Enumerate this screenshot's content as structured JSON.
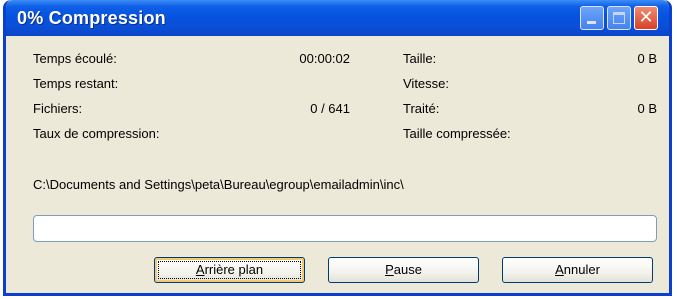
{
  "window": {
    "title": "0% Compression",
    "controls": {
      "minimize": "minimize-icon",
      "maximize": "maximize-icon",
      "close": "close-icon"
    }
  },
  "stats": {
    "elapsed_label": "Temps écoulé:",
    "elapsed_value": "00:00:02",
    "remaining_label": "Temps restant:",
    "files_label": "Fichiers:",
    "files_value": "0 / 641",
    "ratio_label": "Taux de compression:",
    "size_label": "Taille:",
    "size_value": "0 B",
    "speed_label": "Vitesse:",
    "processed_label": "Traité:",
    "processed_value": "0 B",
    "compressed_size_label": "Taille compressée:"
  },
  "current_path": "C:\\Documents and Settings\\peta\\Bureau\\egroup\\emailadmin\\inc\\",
  "progress": {
    "percent": 0
  },
  "buttons": {
    "background": {
      "mnemonic": "A",
      "rest": "rrière plan"
    },
    "pause": {
      "mnemonic": "P",
      "rest": "ause"
    },
    "cancel": {
      "mnemonic": "A",
      "rest": "nnuler"
    }
  },
  "colors": {
    "titlebar": "#0553e0",
    "window_bg": "#ece9d8",
    "progress_fill": "#2bd03a"
  }
}
